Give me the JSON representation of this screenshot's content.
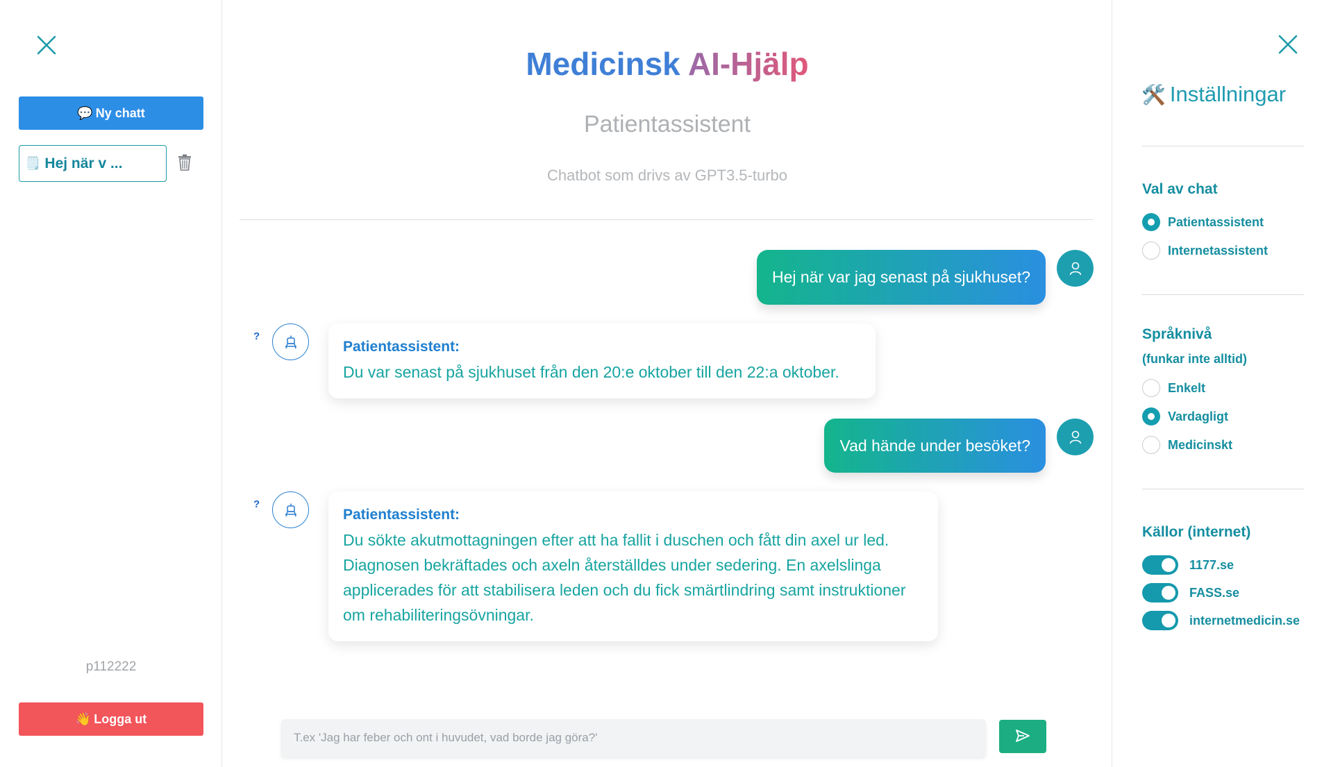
{
  "left_sidebar": {
    "new_chat_label": "Ny chatt",
    "chats": [
      {
        "title": "Hej när v ..."
      }
    ],
    "user_id": "p112222",
    "logout_label": "Logga ut"
  },
  "header": {
    "title_part1": "Medicinsk",
    "title_part2": "AI-Hjälp",
    "subtitle": "Patientassistent",
    "caption": "Chatbot som drivs av GPT3.5-turbo"
  },
  "messages": [
    {
      "role": "user",
      "text": "Hej när var jag senast på sjukhuset?"
    },
    {
      "role": "bot",
      "marker": "?",
      "name": "Patientassistent:",
      "text": "Du var senast på sjukhuset från den 20:e oktober till den 22:a oktober."
    },
    {
      "role": "user",
      "text": "Vad hände under besöket?"
    },
    {
      "role": "bot",
      "marker": "?",
      "name": "Patientassistent:",
      "text": "Du sökte akutmottagningen efter att ha fallit i duschen och fått din axel ur led. Diagnosen bekräftades och axeln återställdes under sedering. En axelslinga applicerades för att stabilisera leden och du fick smärtlindring samt instruktioner om rehabiliteringsövningar."
    }
  ],
  "composer": {
    "placeholder": "T.ex 'Jag har feber och ont i huvudet, vad borde jag göra?'",
    "value": ""
  },
  "settings": {
    "title": "Inställningar",
    "chat_choice": {
      "title": "Val av chat",
      "options": [
        {
          "label": "Patientassistent",
          "selected": true
        },
        {
          "label": "Internetassistent",
          "selected": false
        }
      ]
    },
    "language_level": {
      "title": "Språknivå",
      "subtitle": "(funkar inte alltid)",
      "options": [
        {
          "label": "Enkelt",
          "selected": false
        },
        {
          "label": "Vardagligt",
          "selected": true
        },
        {
          "label": "Medicinskt",
          "selected": false
        }
      ]
    },
    "sources": {
      "title": "Källor (internet)",
      "items": [
        {
          "label": "1177.se",
          "enabled": true
        },
        {
          "label": "FASS.se",
          "enabled": true
        },
        {
          "label": "internetmedicin.se",
          "enabled": true
        }
      ]
    }
  },
  "colors": {
    "accent": "#1f9bb0",
    "new_chat_button": "#2d8ee6",
    "logout_button": "#f2555a",
    "send_button": "#1cae82",
    "user_bubble_start": "#14b58c",
    "user_bubble_end": "#2a8fe0"
  },
  "icons": {
    "new_chat": "speech-bubble-icon",
    "chat_item": "notepad-icon",
    "logout": "waving-hand-icon",
    "settings": "tools-icon",
    "delete": "trash-icon",
    "send": "paper-plane-icon"
  }
}
